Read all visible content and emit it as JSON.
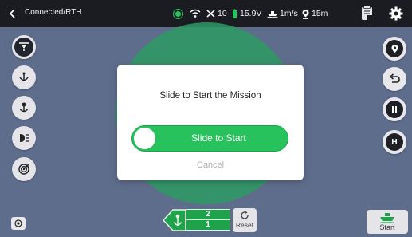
{
  "topbar": {
    "status": "Connected/RTH",
    "satellites": "10",
    "voltage": "15.9V",
    "speed": "1m/s",
    "altitude": "15m",
    "icons": [
      "back-icon",
      "connection-dot-icon",
      "wifi-icon",
      "satellite-icon",
      "battery-icon",
      "boat-speed-icon",
      "location-pin-icon",
      "log-icon",
      "gear-icon"
    ]
  },
  "left_toolbar": {
    "icons": [
      "download-icon",
      "anchor-arc-icon",
      "anchor-icon",
      "light-icon",
      "radar-icon",
      "target-icon"
    ]
  },
  "right_toolbar": {
    "icons": [
      "location-pin-icon",
      "return-icon",
      "pause-icon",
      "home-icon"
    ],
    "home_letter": "H"
  },
  "waypoints": {
    "top": "2",
    "bottom": "1"
  },
  "reset": {
    "label": "Reset"
  },
  "start": {
    "label": "Start"
  },
  "dialog": {
    "title": "Slide to Start the Mission",
    "slider_label": "Slide to Start",
    "cancel_label": "Cancel"
  },
  "colors": {
    "background": "#5f6d8d",
    "topbar": "#1b1c21",
    "accent_green": "#27c25c",
    "map_circle": "#2e9a64"
  }
}
